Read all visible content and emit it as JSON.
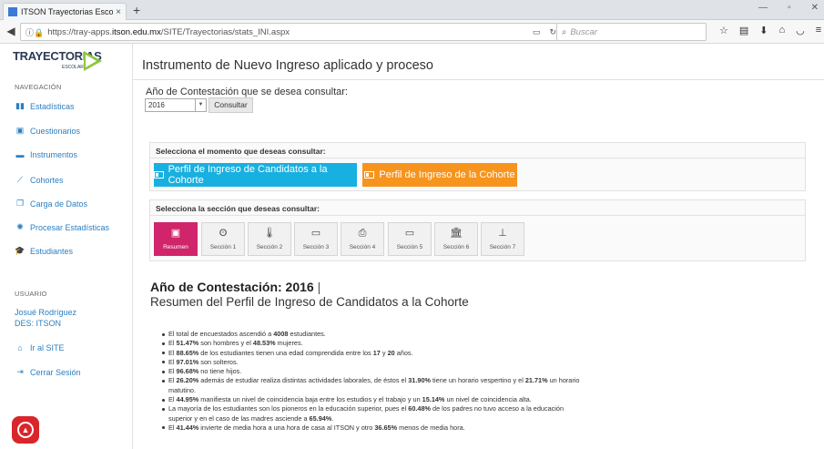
{
  "browser": {
    "tab_title": "ITSON Trayectorias Escolares",
    "tab_close": "×",
    "new_tab": "+",
    "url_prefix": "https://tray-apps.",
    "url_host": "itson.edu.mx",
    "url_path": "/SITE/Trayectorias/stats_INI.aspx",
    "search_placeholder": "Buscar"
  },
  "sidebar": {
    "logo_text": "TRAYECTORIAS",
    "logo_sub": "ESCOLARES",
    "nav_label": "NAVEGACIÓN",
    "nav_items": [
      {
        "label": "Estadísticas",
        "icon": "bar-chart-icon"
      },
      {
        "label": "Cuestionarios",
        "icon": "square-icon"
      },
      {
        "label": "Instrumentos",
        "icon": "list-icon"
      },
      {
        "label": "Cohortes",
        "icon": "line-chart-icon"
      },
      {
        "label": "Carga de Datos",
        "icon": "copy-icon"
      },
      {
        "label": "Procesar Estadísticas",
        "icon": "spinner-icon"
      },
      {
        "label": "Estudiantes",
        "icon": "graduation-icon"
      }
    ],
    "user_label": "USUARIO",
    "user_name": "Josué Rodríguez",
    "user_des": "DES: ITSON",
    "user_items": [
      {
        "label": "Ir al SITE",
        "icon": "home-icon"
      },
      {
        "label": "Cerrar Sesión",
        "icon": "sign-out-icon"
      }
    ]
  },
  "main": {
    "title": "Instrumento de Nuevo Ingreso aplicado y proceso",
    "year_question": "Año de Contestación que se desea consultar:",
    "year_value": "2016",
    "consult_button": "Consultar",
    "moment_label": "Selecciona el momento que deseas consultar:",
    "moment_buttons": [
      "Perfil de Ingreso de Candidatos a la Cohorte",
      "Perfil de Ingreso de la Cohorte"
    ],
    "section_label": "Selecciona la sección que deseas consultar:",
    "sections": [
      {
        "label": "Resumen",
        "icon": "card-icon"
      },
      {
        "label": "Sección 1",
        "icon": "user-icon"
      },
      {
        "label": "Sección 2",
        "icon": "thermometer-icon"
      },
      {
        "label": "Sección 3",
        "icon": "money-icon"
      },
      {
        "label": "Sección 4",
        "icon": "printer-icon"
      },
      {
        "label": "Sección 5",
        "icon": "laptop-icon"
      },
      {
        "label": "Sección 6",
        "icon": "institution-icon"
      },
      {
        "label": "Sección 7",
        "icon": "sitemap-icon"
      }
    ],
    "result_year_heading": "Año de Contestación: 2016",
    "result_subheading": "Resumen del Perfil de Ingreso de Candidatos a la Cohorte",
    "bullets": [
      [
        "El total de encuestados ascendió a ",
        "4008",
        " estudiantes."
      ],
      [
        "El ",
        "51.47%",
        " son hombres y el ",
        "48.53%",
        " mujeres."
      ],
      [
        "El ",
        "88.65%",
        " de los estudiantes tienen una edad comprendida entre los ",
        "17",
        " y ",
        "20",
        " años."
      ],
      [
        "El ",
        "97.01%",
        " son solteros."
      ],
      [
        "El ",
        "96.68%",
        " no tiene hijos."
      ],
      [
        "El ",
        "26.20%",
        " además de estudiar realiza distintas actividades laborales, de éstos el ",
        "31.90%",
        " tiene un horario vespertino y el ",
        "21.71%",
        " un horario matutino."
      ],
      [
        "El ",
        "44.95%",
        " manifiesta un nivel de coincidencia baja entre los estudios y el trabajo y un ",
        "15.14%",
        " un nivel de coincidencia alta."
      ],
      [
        "La mayoría de los estudiantes son los pioneros en la educación superior, pues el ",
        "60.48%",
        " de los padres no tuvo acceso a la educación superior y en el caso de las madres asciende a ",
        "65.94%",
        "."
      ],
      [
        "El ",
        "41.44%",
        " invierte de media hora a una hora de casa al ITSON y otro ",
        "36.65%",
        " menos de media hora."
      ]
    ]
  },
  "colors": {
    "accent_cyan": "#18b0e0",
    "accent_orange": "#f7941d",
    "active_section": "#d0246b",
    "link_blue": "#2b7fc2",
    "fab_red": "#d8262b"
  }
}
